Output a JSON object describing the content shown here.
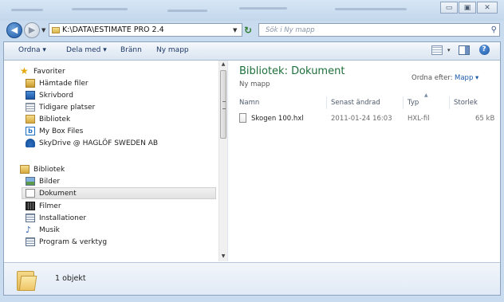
{
  "address": {
    "path": "K:\\DATA\\ESTIMATE PRO 2.4",
    "search_placeholder": "Sök i Ny mapp"
  },
  "window_controls": {
    "minimize": "▭",
    "maximize": "▣",
    "close": "✕"
  },
  "toolbar": {
    "organize": "Ordna ▾",
    "share": "Dela med ▾",
    "burn": "Bränn",
    "new_folder": "Ny mapp",
    "view_dropdown": "▾"
  },
  "nav": {
    "favorites_header": "Favoriter",
    "favorites": [
      {
        "label": "Hämtade filer",
        "icon": "downloads-icon"
      },
      {
        "label": "Skrivbord",
        "icon": "desktop-icon"
      },
      {
        "label": "Tidigare platser",
        "icon": "recent-places-icon"
      },
      {
        "label": "Bibliotek",
        "icon": "library-icon"
      },
      {
        "label": "My Box Files",
        "icon": "box-icon"
      },
      {
        "label": "SkyDrive @ HAGLÖF SWEDEN AB",
        "icon": "skydrive-icon"
      }
    ],
    "libraries_header": "Bibliotek",
    "libraries": [
      {
        "label": "Bilder",
        "icon": "pictures-icon"
      },
      {
        "label": "Dokument",
        "icon": "documents-icon",
        "selected": true
      },
      {
        "label": "Filmer",
        "icon": "videos-icon"
      },
      {
        "label": "Installationer",
        "icon": "installations-icon"
      },
      {
        "label": "Musik",
        "icon": "music-icon"
      },
      {
        "label": "Program & verktyg",
        "icon": "programs-icon"
      }
    ]
  },
  "content": {
    "library_title": "Bibliotek: Dokument",
    "library_subtitle": "Ny mapp",
    "arrange_label": "Ordna efter:",
    "arrange_value": "Mapp ▾",
    "columns": {
      "name": "Namn",
      "modified": "Senast ändrad",
      "type": "Typ",
      "size": "Storlek"
    },
    "files": [
      {
        "name": "Skogen 100.hxl",
        "modified": "2011-01-24 16:03",
        "type": "HXL-fil",
        "size": "65 kB"
      }
    ]
  },
  "status": {
    "count": "1 objekt"
  },
  "colors": {
    "library_title": "#1e6f3a",
    "link_blue": "#1e5aa8",
    "frame": "#c9dbee"
  }
}
